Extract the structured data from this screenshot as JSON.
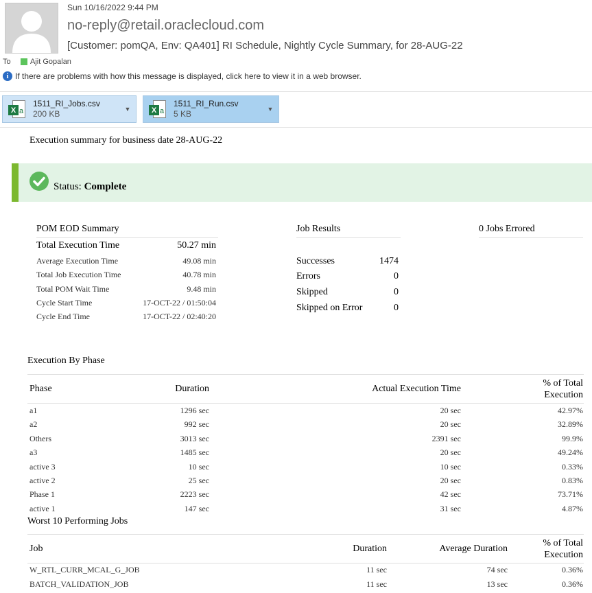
{
  "header": {
    "date": "Sun 10/16/2022 9:44 PM",
    "from": "no-reply@retail.oraclecloud.com",
    "subject": "[Customer: pomQA, Env: QA401] RI Schedule, Nightly Cycle Summary, for 28-AUG-22",
    "to_label": "To",
    "to_name": "Ajit Gopalan",
    "info_text": "If there are problems with how this message is displayed, click here to view it in a web browser."
  },
  "attachments": [
    {
      "name": "1511_RI_Jobs.csv",
      "size": "200 KB"
    },
    {
      "name": "1511_RI_Run.csv",
      "size": "5 KB"
    }
  ],
  "body": {
    "exec_summary": "Execution summary for business date 28-AUG-22",
    "status_label": "Status:",
    "status_value": "Complete",
    "pom_title": "POM EOD Summary",
    "pom_rows": [
      {
        "label": "Total Execution Time",
        "value": "50.27 min"
      },
      {
        "label": "Average Execution Time",
        "value": "49.08 min"
      },
      {
        "label": "Total Job Execution Time",
        "value": "40.78 min"
      },
      {
        "label": "Total POM Wait Time",
        "value": "9.48 min"
      },
      {
        "label": "Cycle Start Time",
        "value": "17-OCT-22 / 01:50:04"
      },
      {
        "label": "Cycle End Time",
        "value": "17-OCT-22 / 02:40:20"
      }
    ],
    "job_results_title": "Job Results",
    "job_results": [
      {
        "label": "Successes",
        "value": "1474"
      },
      {
        "label": "Errors",
        "value": "0"
      },
      {
        "label": "Skipped",
        "value": "0"
      },
      {
        "label": "Skipped on Error",
        "value": "0"
      }
    ],
    "jobs_errored": "0 Jobs Errored",
    "phase_title": "Execution By Phase",
    "phase_headers": {
      "phase": "Phase",
      "duration": "Duration",
      "actual": "Actual Execution Time",
      "pct1": "% of Total",
      "pct2": "Execution"
    },
    "phases": [
      {
        "phase": "a1",
        "duration": "1296 sec",
        "actual": "20 sec",
        "pct": "42.97%"
      },
      {
        "phase": "a2",
        "duration": "992 sec",
        "actual": "20 sec",
        "pct": "32.89%"
      },
      {
        "phase": "Others",
        "duration": "3013 sec",
        "actual": "2391 sec",
        "pct": "99.9%"
      },
      {
        "phase": "a3",
        "duration": "1485 sec",
        "actual": "20 sec",
        "pct": "49.24%"
      },
      {
        "phase": "active 3",
        "duration": "10 sec",
        "actual": "10 sec",
        "pct": "0.33%"
      },
      {
        "phase": "active 2",
        "duration": "25 sec",
        "actual": "20 sec",
        "pct": "0.83%"
      },
      {
        "phase": "Phase 1",
        "duration": "2223 sec",
        "actual": "42 sec",
        "pct": "73.71%"
      },
      {
        "phase": "active 1",
        "duration": "147 sec",
        "actual": "31 sec",
        "pct": "4.87%"
      }
    ],
    "worst_title": "Worst 10 Performing Jobs",
    "worst_headers": {
      "job": "Job",
      "duration": "Duration",
      "avg": "Average Duration",
      "pct1": "% of Total",
      "pct2": "Execution"
    },
    "worst_jobs": [
      {
        "job": "W_RTL_CURR_MCAL_G_JOB",
        "duration": "11 sec",
        "avg": "74 sec",
        "pct": "0.36%"
      },
      {
        "job": "BATCH_VALIDATION_JOB",
        "duration": "11 sec",
        "avg": "13 sec",
        "pct": "0.36%"
      }
    ]
  }
}
